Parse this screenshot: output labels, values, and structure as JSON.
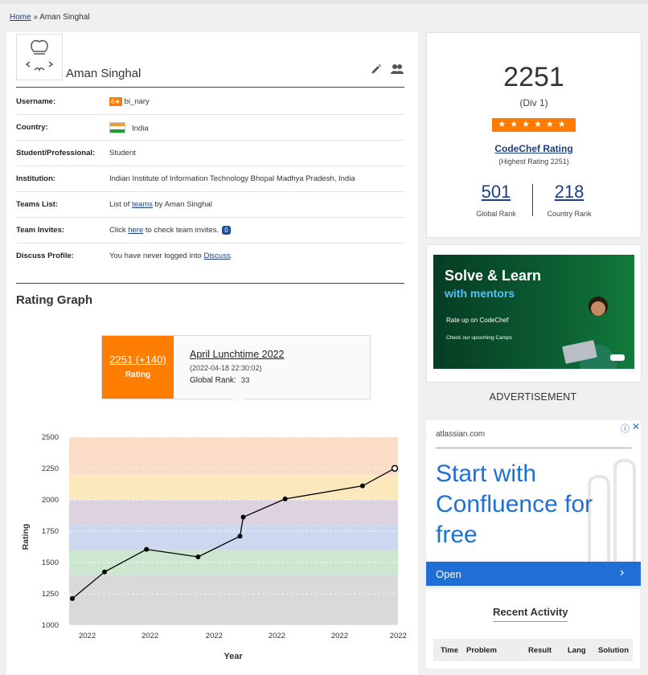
{
  "breadcrumb": {
    "home": "Home",
    "separator": "»",
    "current": "Aman Singhal"
  },
  "profile": {
    "name": "Aman Singhal",
    "fields": [
      {
        "label": "Username:",
        "badge": "6★",
        "value": "bi_nary"
      },
      {
        "label": "Country:",
        "value": "India"
      },
      {
        "label": "Student/Professional:",
        "value": "Student"
      },
      {
        "label": "Institution:",
        "value": "Indian Institute of Information Technology Bhopal Madhya Pradesh, India"
      },
      {
        "label": "Teams List:",
        "prefix": "List of",
        "link": "teams",
        "suffix": "by Aman Singhal"
      },
      {
        "label": "Team Invites:",
        "prefix": "Click",
        "link": "here",
        "suffix": "to check team invites.",
        "count": "0"
      },
      {
        "label": "Discuss Profile:",
        "prefix": "You have never logged into",
        "link": "Discuss",
        "suffix": "."
      }
    ]
  },
  "rating_graph": {
    "title": "Rating Graph",
    "tooltip": {
      "rating": "2251 (+140)",
      "rating_label": "Rating",
      "contest": "April Lunchtime 2022",
      "date": "(2022-04-18 22:30:02)",
      "rank_label": "Global Rank:",
      "rank_value": "33"
    }
  },
  "chart_data": {
    "type": "line",
    "xlabel": "Year",
    "ylabel": "Rating",
    "ylim": [
      1000,
      2500
    ],
    "yticks": [
      1000,
      1250,
      1500,
      1750,
      2000,
      2250,
      2500
    ],
    "xtick_labels": [
      "2022",
      "2022",
      "2022",
      "2022",
      "2022",
      "2022"
    ],
    "bands": [
      {
        "from": 1000,
        "to": 1400,
        "color": "#d9d9d9"
      },
      {
        "from": 1400,
        "to": 1600,
        "color": "#cde6cf"
      },
      {
        "from": 1600,
        "to": 1800,
        "color": "#cbd8f0"
      },
      {
        "from": 1800,
        "to": 2000,
        "color": "#dcd2e0"
      },
      {
        "from": 2000,
        "to": 2200,
        "color": "#fbe9bd"
      },
      {
        "from": 2200,
        "to": 2500,
        "color": "#fbdcc6"
      }
    ],
    "series": [
      {
        "values": [
          1212,
          1425,
          1605,
          1545,
          1710,
          1862,
          2007,
          2111,
          2251
        ]
      }
    ],
    "x_index_positions": [
      0.0,
      0.1,
      0.23,
      0.39,
      0.52,
      0.53,
      0.66,
      0.9,
      1.0
    ]
  },
  "rating_card": {
    "rating": "2251",
    "division": "(Div 1)",
    "stars": "★★★★★★",
    "rating_link": "CodeChef Rating",
    "highest": "(Highest Rating 2251)",
    "global_rank": "501",
    "global_rank_label": "Global Rank",
    "country_rank": "218",
    "country_rank_label": "Country Rank"
  },
  "ad1": {
    "title": "Solve & Learn",
    "subtitle": "with mentors",
    "tagline": "Rate up on CodeChef",
    "camps": "Check our upcoming Camps",
    "caption": "ADVERTISEMENT",
    "colors": {
      "accent": "#4fc3ff",
      "bg": "#0b5a30"
    }
  },
  "ad2": {
    "domain": "atlassian.com",
    "info": "ⓘ",
    "close": "✕",
    "headline": "Start with Confluence for free",
    "cta": "Open",
    "chevron": "›",
    "accent": "#1f6fd6"
  },
  "activity": {
    "title": "Recent Activity",
    "columns": [
      "Time",
      "Problem",
      "Result",
      "Lang",
      "Solution"
    ]
  }
}
